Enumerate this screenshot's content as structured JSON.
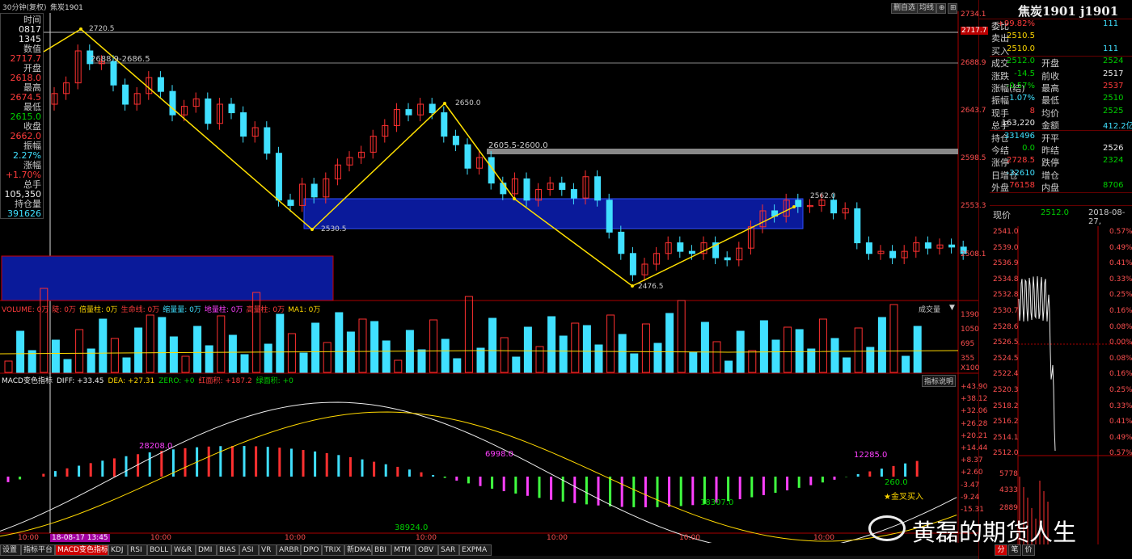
{
  "header": {
    "period": "30分钟(复权)",
    "symbol": "焦炭1901",
    "tools": [
      "删自选",
      "均线",
      "",
      "⊞"
    ]
  },
  "left_panel": [
    {
      "label": "时间",
      "value": "0817",
      "value2": "1345",
      "color": "wht"
    },
    {
      "label": "数值",
      "value": "2717.7",
      "color": "red"
    },
    {
      "label": "开盘",
      "value": "2618.0",
      "color": "red"
    },
    {
      "label": "最高",
      "value": "2674.5",
      "color": "red"
    },
    {
      "label": "最低",
      "value": "2615.0",
      "color": "grn"
    },
    {
      "label": "收盘",
      "value": "2662.0",
      "color": "red"
    },
    {
      "label": "振幅",
      "value": "2.27%",
      "color": "cyn"
    },
    {
      "label": "涨幅",
      "value": "+1.70%",
      "color": "red"
    },
    {
      "label": "总手",
      "value": "105,350",
      "color": "wht"
    },
    {
      "label": "持仓量",
      "value": "391626",
      "color": "cyn"
    }
  ],
  "price_axis": [
    "2734.1",
    "2717.7",
    "2688.9",
    "2643.7",
    "2598.5",
    "2553.3",
    "2508.1"
  ],
  "vol_axis": [
    "1390",
    "1050",
    "695",
    "355",
    "X100"
  ],
  "macd_axis": [
    "+43.90",
    "+38.12",
    "+32.06",
    "+26.28",
    "+20.21",
    "+14.44",
    "+8.37",
    "+2.60",
    "-3.47",
    "-9.24",
    "-15.31"
  ],
  "annotations": {
    "p1": "2720.5",
    "p2": "2688.9-2686.5",
    "p3": "2650.0",
    "p4": "2605.5-2600.0",
    "p5": "2562.0",
    "p6": "2530.5",
    "p7": "2476.5",
    "m1": "28208.0",
    "m2": "6998.0",
    "m3": "12285.0",
    "m4": "260.0",
    "m5": "18307.0",
    "m6": "38924.0",
    "golden": "金叉买入"
  },
  "vol_header": {
    "items": [
      {
        "t": "VOLUME: 0万",
        "c": "red"
      },
      {
        "t": "陡: 0万",
        "c": "red"
      },
      {
        "t": "倍量柱: 0万",
        "c": "yel"
      },
      {
        "t": "生命线: 0万",
        "c": "red"
      },
      {
        "t": "缩量量: 0万",
        "c": "cyn"
      },
      {
        "t": "地量柱: 0万",
        "c": "mag"
      },
      {
        "t": "高量柱: 0万",
        "c": "red"
      },
      {
        "t": "MA1: 0万",
        "c": "yel"
      }
    ],
    "right": "成交量"
  },
  "macd_header": {
    "items": [
      {
        "t": "MACD变色指标",
        "c": "wht"
      },
      {
        "t": "DIFF: +33.45",
        "c": "wht"
      },
      {
        "t": "DEA: +27.31",
        "c": "yel"
      },
      {
        "t": "ZERO: +0",
        "c": "grn"
      },
      {
        "t": "红面积: +187.2",
        "c": "red"
      },
      {
        "t": "绿面积: +0",
        "c": "grn"
      }
    ],
    "right": "指标说明"
  },
  "time_axis": {
    "labels": [
      "10:00",
      "18-08-17 13:45",
      "10:00",
      "10:00",
      "10:00",
      "10:00",
      "10:00",
      "10:00"
    ]
  },
  "bottom_tabs": [
    "设置",
    "指标平台",
    "MACD变色指标",
    "KDJ",
    "RSI",
    "BOLL",
    "W&R",
    "DMI",
    "BIAS",
    "ASI",
    "VR",
    "ARBR",
    "DPO",
    "TRIX",
    "新DMA",
    "BBI",
    "MTM",
    "OBV",
    "SAR",
    "EXPMA"
  ],
  "quote": {
    "title": "焦炭1901 j1901",
    "rows": [
      {
        "a": "委比",
        "b": "+99.82%",
        "bc": "red",
        "c": "",
        "cv": "111",
        "cc": "cyn"
      },
      {
        "a": "卖出",
        "b": "2510.5",
        "bc": "yel",
        "c": "",
        "cv": "",
        "cc": ""
      },
      {
        "a": "买入",
        "b": "2510.0",
        "bc": "yel",
        "c": "",
        "cv": "111",
        "cc": "cyn"
      },
      {
        "a": "成交",
        "b": "2512.0",
        "bc": "grn",
        "c": "开盘",
        "cv": "2524",
        "cc": "grn"
      },
      {
        "a": "涨跌",
        "b": "-14.5",
        "bc": "grn",
        "c": "前收",
        "cv": "2517",
        "cc": "wht"
      },
      {
        "a": "涨幅(结)",
        "b": "-0.57%",
        "bc": "grn",
        "c": "最高",
        "cv": "2537",
        "cc": "red"
      },
      {
        "a": "振幅",
        "b": "1.07%",
        "bc": "cyn",
        "c": "最低",
        "cv": "2510",
        "cc": "grn"
      },
      {
        "a": "现手",
        "b": "8",
        "bc": "red",
        "c": "均价",
        "cv": "2525",
        "cc": "grn"
      },
      {
        "a": "总手",
        "b": "163,220",
        "bc": "wht",
        "c": "金额",
        "cv": "412.2亿",
        "cc": "cyn"
      },
      {
        "a": "持仓",
        "b": "331496",
        "bc": "cyn",
        "c": "开平",
        "cv": "",
        "cc": ""
      },
      {
        "a": "今结",
        "b": "0.0",
        "bc": "grn",
        "c": "昨结",
        "cv": "2526",
        "cc": "wht"
      },
      {
        "a": "涨停",
        "b": "2728.5",
        "bc": "red",
        "c": "跌停",
        "cv": "2324",
        "cc": "grn"
      },
      {
        "a": "日增仓",
        "b": "-32610",
        "bc": "cyn",
        "c": "增仓",
        "cv": "",
        "cc": ""
      },
      {
        "a": "外盘",
        "b": "76158",
        "bc": "red",
        "c": "内盘",
        "cv": "8706",
        "cc": "grn"
      }
    ],
    "now_label": "现价",
    "now_value": "2512.0",
    "now_time": "2018-08-27,"
  },
  "mini_chart": {
    "left": [
      "2541.0",
      "2539.0",
      "2536.9",
      "2534.8",
      "2532.8",
      "2530.7",
      "2528.6",
      "2526.5",
      "2524.5",
      "2522.4",
      "2520.3",
      "2518.2",
      "2516.2",
      "2514.1",
      "2512.0"
    ],
    "right": [
      "0.57%",
      "0.49%",
      "0.41%",
      "0.33%",
      "0.25%",
      "0.16%",
      "0.08%",
      "0.00%",
      "0.08%",
      "0.16%",
      "0.25%",
      "0.33%",
      "0.41%",
      "0.49%",
      "0.57%"
    ],
    "vol": [
      "5778",
      "4333",
      "2889"
    ]
  },
  "bottom_tabs_right": [
    "分",
    "笔",
    "价"
  ],
  "watermark": "黄磊的期货人生",
  "chart_data": {
    "type": "candlestick",
    "title": "焦炭1901",
    "ylim": [
      2476.5,
      2734.1
    ]
  }
}
